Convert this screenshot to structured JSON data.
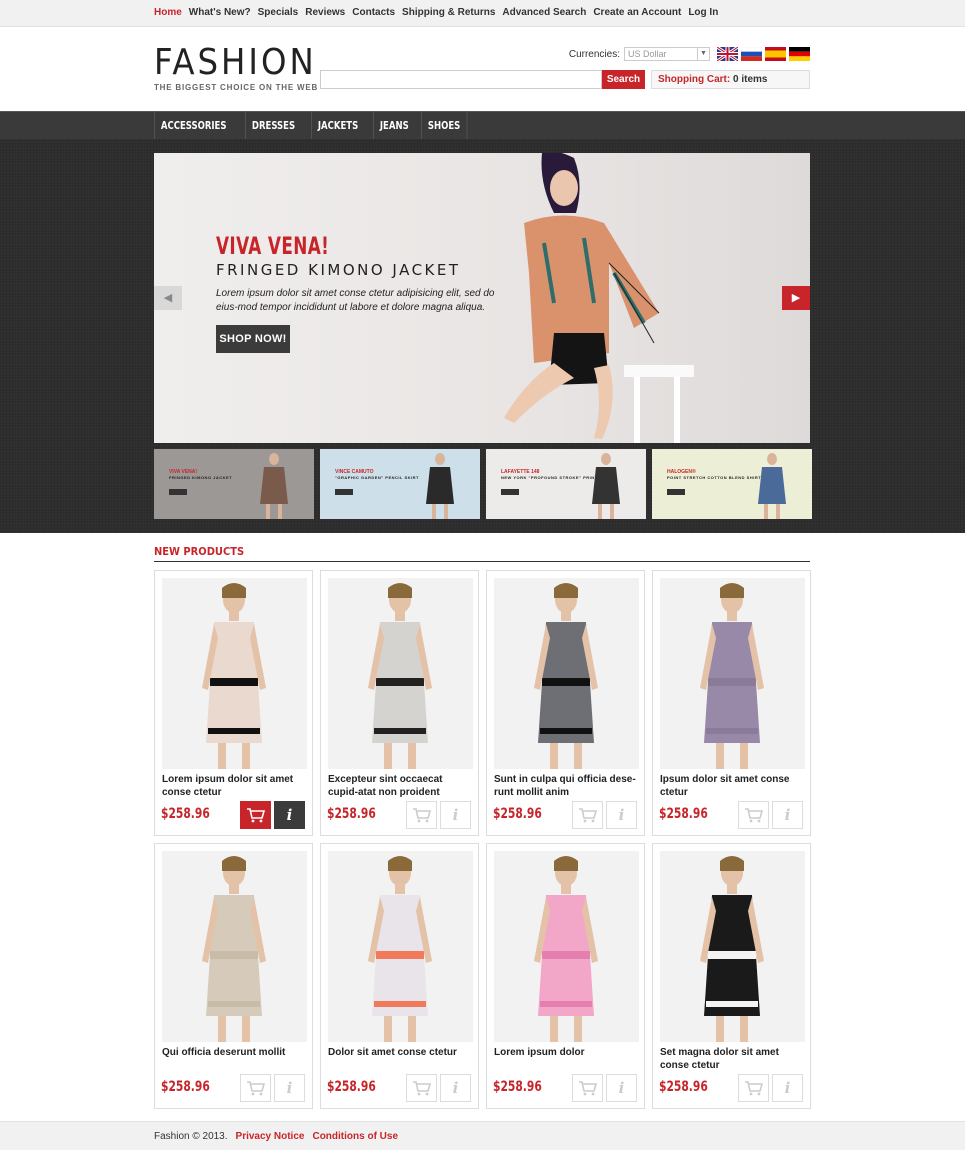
{
  "topnav": [
    {
      "label": "Home",
      "active": true
    },
    {
      "label": "What's New?"
    },
    {
      "label": "Specials"
    },
    {
      "label": "Reviews"
    },
    {
      "label": "Contacts"
    },
    {
      "label": "Shipping & Returns"
    },
    {
      "label": "Advanced Search"
    },
    {
      "label": "Create an Account"
    },
    {
      "label": "Log In"
    }
  ],
  "logo": {
    "name": "FASHION",
    "tagline": "THE BIGGEST CHOICE ON THE WEB"
  },
  "currency": {
    "label": "Currencies:",
    "selected": "US Dollar"
  },
  "flags": [
    "uk-flag-icon",
    "russia-flag-icon",
    "spain-flag-icon",
    "germany-flag-icon"
  ],
  "search": {
    "placeholder": "",
    "button": "Search"
  },
  "cart": {
    "label": "Shopping Cart:",
    "value": "0 items"
  },
  "menu": [
    "Accessories",
    "Dresses",
    "Jackets",
    "Jeans",
    "Shoes"
  ],
  "hero": {
    "title": "VIVA VENA!",
    "subtitle": "FRINGED KIMONO JACKET",
    "description": "Lorem ipsum dolor sit amet conse ctetur adipisicing elit, sed do eius-mod tempor incididunt ut labore et dolore magna aliqua.",
    "button": "SHOP NOW!"
  },
  "thumbs": [
    {
      "t1": "VIVA VENA!",
      "t2": "FRINGED KIMONO JACKET",
      "bg": "#9c9896"
    },
    {
      "t1": "VINCE CAMUTO",
      "t2": "\"GRAPHIC GARDEN\" PENCIL SKIRT",
      "bg": "#cde0ea"
    },
    {
      "t1": "LAFAYETTE 148",
      "t2": "NEW YORK \"PROFOUND STROKE\" PRINT TUNIC",
      "bg": "#ecebea"
    },
    {
      "t1": "HALOGEN®",
      "t2": "POINT STRETCH COTTON BLEND SHIRT",
      "bg": "#ecefd6"
    }
  ],
  "section_title": "NEW PRODUCTS",
  "products": [
    {
      "title": "Lorem ipsum dolor sit amet conse ctetur",
      "price": "$258.96",
      "dress": "#e9d9cf",
      "trim": "#111",
      "highlight": true
    },
    {
      "title": "Excepteur sint occaecat cupid-atat non proident",
      "price": "$258.96",
      "dress": "#d5d3d0",
      "trim": "#222",
      "highlight": false
    },
    {
      "title": "Sunt in culpa qui officia dese-runt mollit anim",
      "price": "$258.96",
      "dress": "#6e6f75",
      "trim": "#111",
      "highlight": false
    },
    {
      "title": "Ipsum dolor sit amet conse ctetur",
      "price": "$258.96",
      "dress": "#9889a8",
      "trim": "#8a7b98",
      "highlight": false
    },
    {
      "title": "Qui officia deserunt mollit",
      "price": "$258.96",
      "dress": "#d6cbbb",
      "trim": "#c8bca9",
      "highlight": false
    },
    {
      "title": "Dolor sit amet conse ctetur",
      "price": "$258.96",
      "dress": "#e9e4ea",
      "trim": "#f07a5a",
      "highlight": false
    },
    {
      "title": "Lorem ipsum dolor",
      "price": "$258.96",
      "dress": "#f2a6c8",
      "trim": "#e57fb0",
      "highlight": false
    },
    {
      "title": "Set magna dolor sit amet conse ctetur",
      "price": "$258.96",
      "dress": "#1a1a1a",
      "trim": "#f4f4f4",
      "highlight": false
    }
  ],
  "footer": {
    "copy": "Fashion © 2013.",
    "privacy": "Privacy Notice",
    "conditions": "Conditions of Use"
  }
}
